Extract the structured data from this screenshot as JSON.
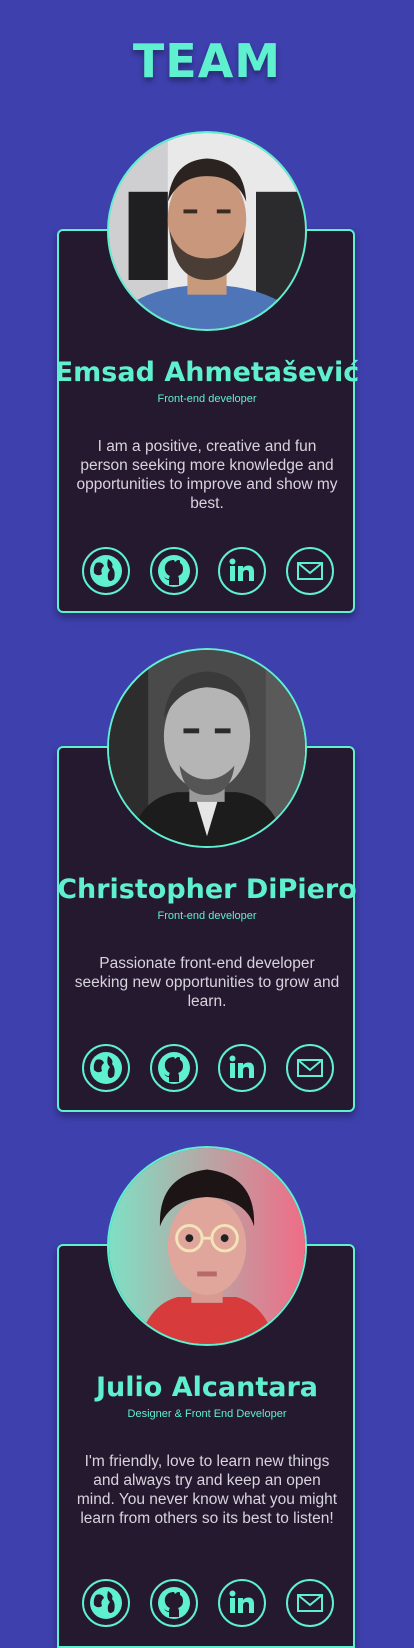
{
  "header": {
    "title": "TEAM"
  },
  "members": [
    {
      "name": "Emsad Ahmetašević",
      "role": "Front-end developer",
      "bio": "I am a positive, creative and fun person seeking more knowledge and opportunities to improve and show my best.",
      "links": [
        "website-icon",
        "github-icon",
        "linkedin-icon",
        "email-icon"
      ]
    },
    {
      "name": "Christopher DiPiero",
      "role": "Front-end developer",
      "bio": "Passionate front-end developer seeking new opportunities to grow and learn.",
      "links": [
        "website-icon",
        "github-icon",
        "linkedin-icon",
        "email-icon"
      ]
    },
    {
      "name": "Julio Alcantara",
      "role": "Designer & Front End Developer",
      "bio": "I'm friendly, love to learn new things and always try and keep an open mind. You never know what you might learn from others so its best to listen!",
      "links": [
        "website-icon",
        "github-icon",
        "linkedin-icon",
        "email-icon"
      ]
    }
  ],
  "colors": {
    "background": "#3e40ae",
    "card": "#25192f",
    "accent": "#5ff0cf",
    "text": "#d8d4de"
  }
}
